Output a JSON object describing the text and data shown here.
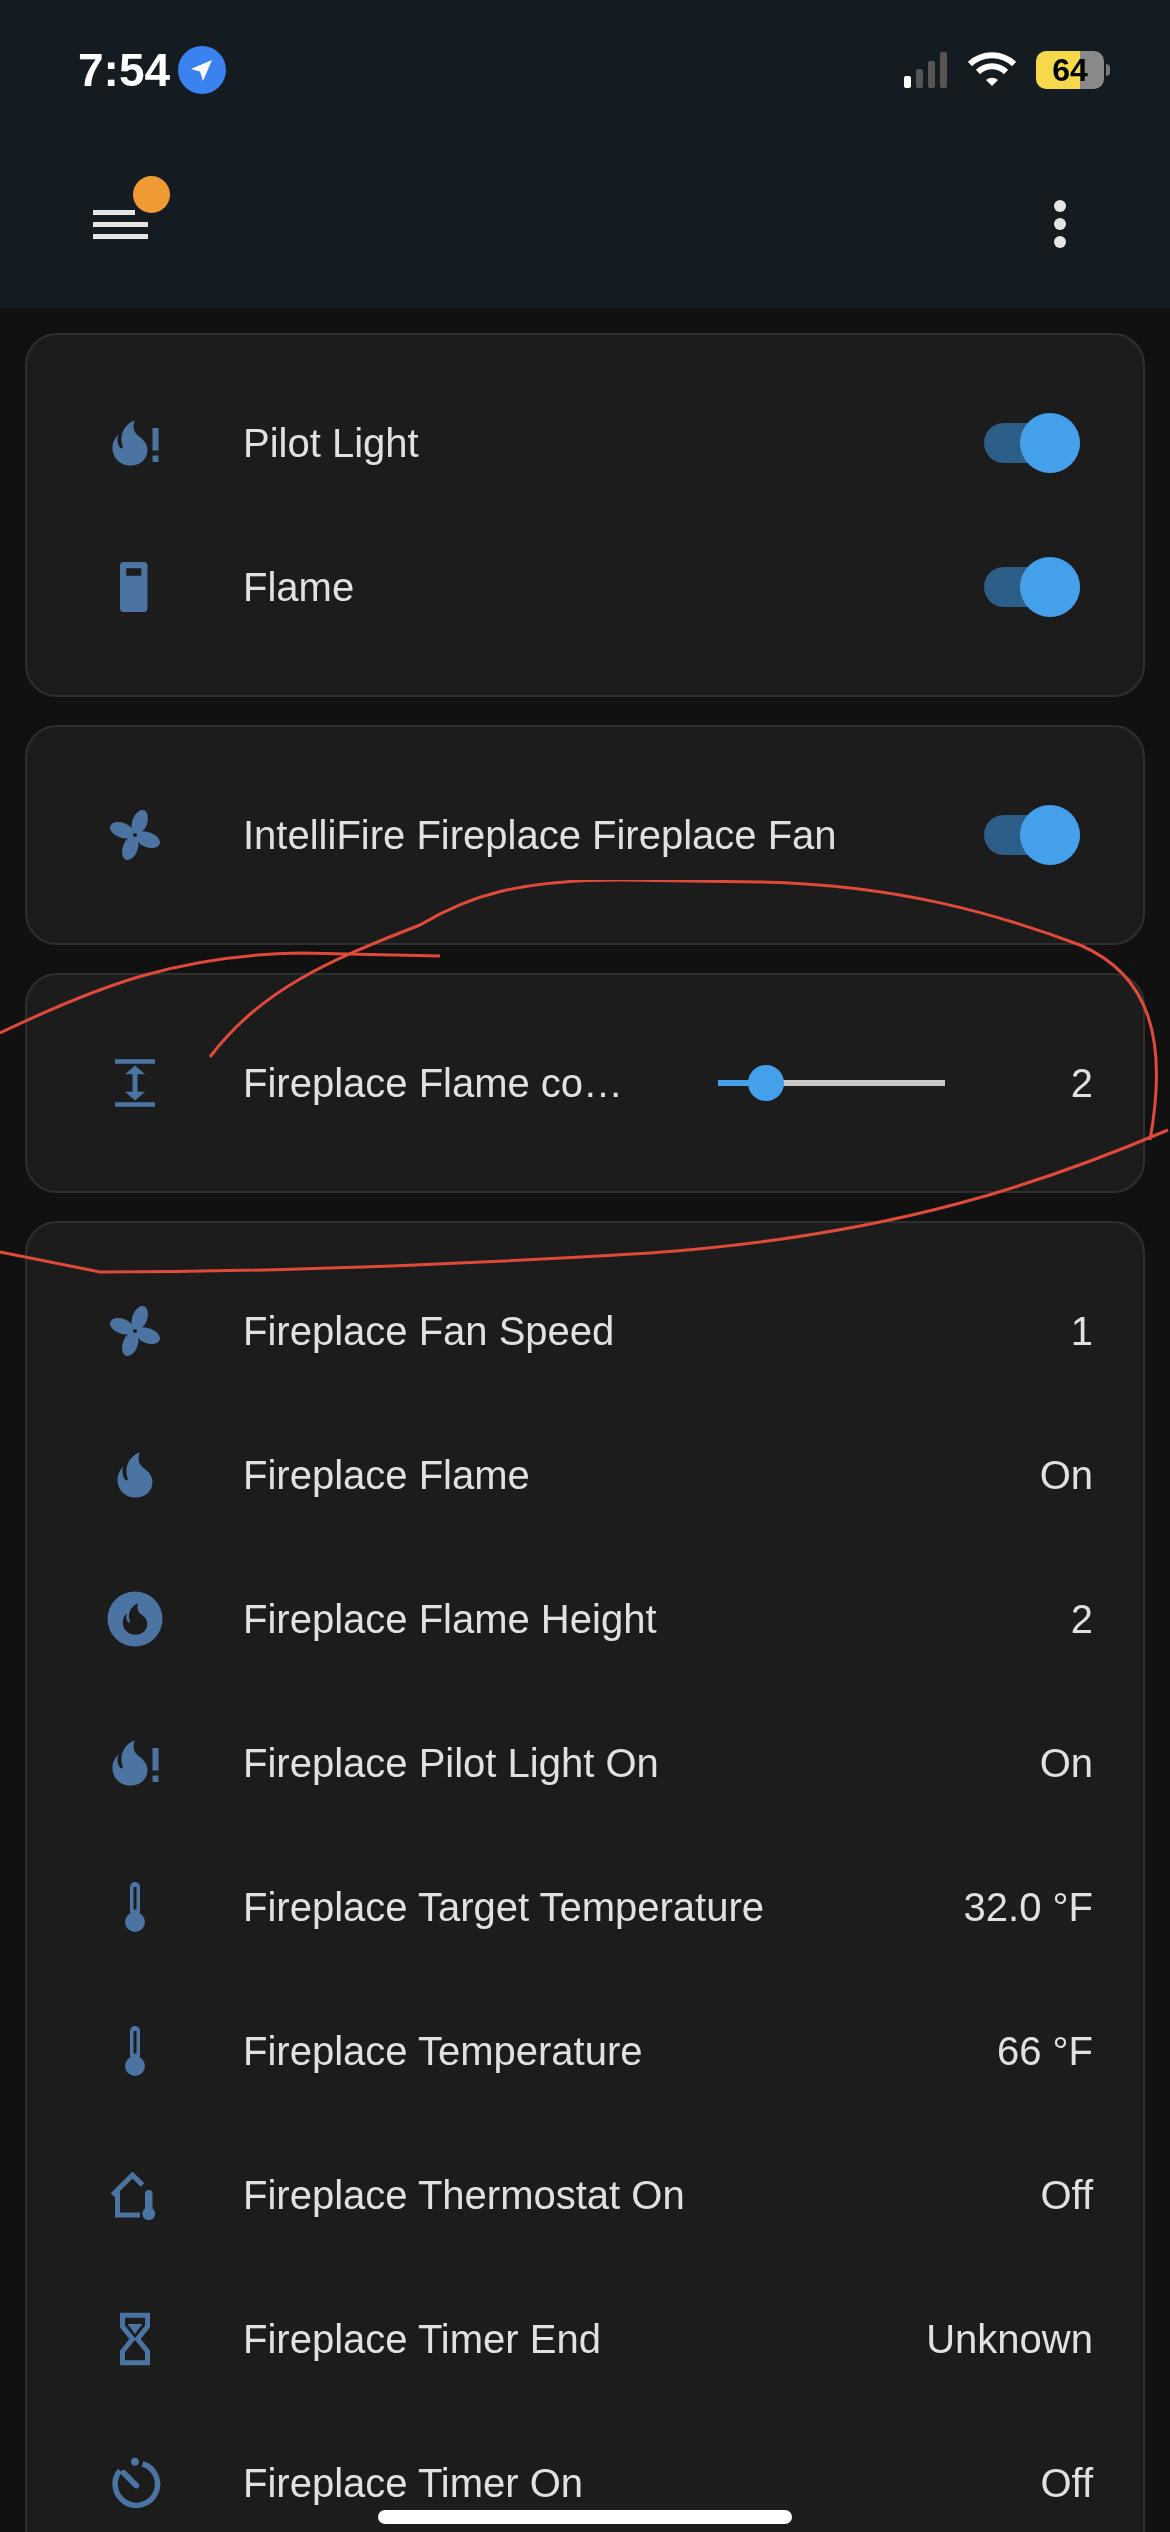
{
  "status_bar": {
    "time": "7:54",
    "battery": "64"
  },
  "header": {
    "menu_badge": true
  },
  "cards": [
    {
      "rows": [
        {
          "kind": "toggle",
          "label": "Pilot Light",
          "on": true
        },
        {
          "kind": "toggle",
          "label": "Flame",
          "on": true
        }
      ]
    },
    {
      "rows": [
        {
          "kind": "toggle",
          "label": "IntelliFire Fireplace Fireplace Fan",
          "on": true
        }
      ]
    },
    {
      "rows": [
        {
          "kind": "slider",
          "label": "Fireplace Flame co…",
          "level": 0.21,
          "value": "2"
        }
      ]
    },
    {
      "rows": [
        {
          "kind": "state",
          "label": "Fireplace Fan Speed",
          "value": "1"
        },
        {
          "kind": "state",
          "label": "Fireplace Flame",
          "value": "On"
        },
        {
          "kind": "state",
          "label": "Fireplace Flame Height",
          "value": "2"
        },
        {
          "kind": "state",
          "label": "Fireplace Pilot Light On",
          "value": "On"
        },
        {
          "kind": "state",
          "label": "Fireplace Target Temperature",
          "value": "32.0 °F"
        },
        {
          "kind": "state",
          "label": "Fireplace Temperature",
          "value": "66 °F"
        },
        {
          "kind": "state",
          "label": "Fireplace Thermostat On",
          "value": "Off"
        },
        {
          "kind": "state",
          "label": "Fireplace Timer End",
          "value": "Unknown"
        },
        {
          "kind": "state",
          "label": "Fireplace Timer On",
          "value": "Off"
        }
      ]
    }
  ]
}
